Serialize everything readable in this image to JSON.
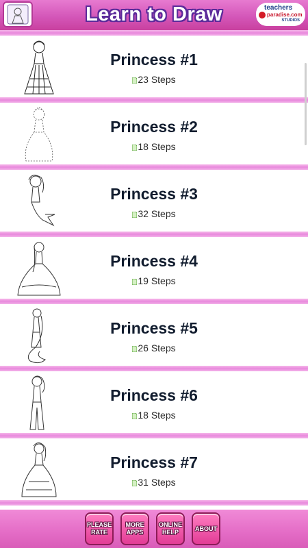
{
  "header": {
    "title": "Learn to Draw",
    "brand": {
      "line1": "teachers",
      "line2": "paradise.com",
      "line3": "STUDIOS"
    },
    "colors": {
      "bar": "#d457b9",
      "title_outline": "#5b2a9a"
    }
  },
  "items": [
    {
      "name": "Princess #1",
      "steps": "23 Steps",
      "thumb_icon": "princess-drawing-icon"
    },
    {
      "name": "Princess #2",
      "steps": "18 Steps",
      "thumb_icon": "princess-drawing-icon"
    },
    {
      "name": "Princess #3",
      "steps": "32 Steps",
      "thumb_icon": "mermaid-drawing-icon"
    },
    {
      "name": "Princess #4",
      "steps": "19 Steps",
      "thumb_icon": "princess-drawing-icon"
    },
    {
      "name": "Princess #5",
      "steps": "26 Steps",
      "thumb_icon": "princess-drawing-icon"
    },
    {
      "name": "Princess #6",
      "steps": "18 Steps",
      "thumb_icon": "princess-drawing-icon"
    },
    {
      "name": "Princess #7",
      "steps": "31 Steps",
      "thumb_icon": "princess-drawing-icon"
    }
  ],
  "footer": {
    "buttons": [
      {
        "label": "PLEASE\nRATE"
      },
      {
        "label": "MORE\nAPPS"
      },
      {
        "label": "ONLINE\nHELP"
      },
      {
        "label": "ABOUT"
      }
    ],
    "colors": {
      "bar": "#e46cc6",
      "button": "#e23c96"
    }
  }
}
